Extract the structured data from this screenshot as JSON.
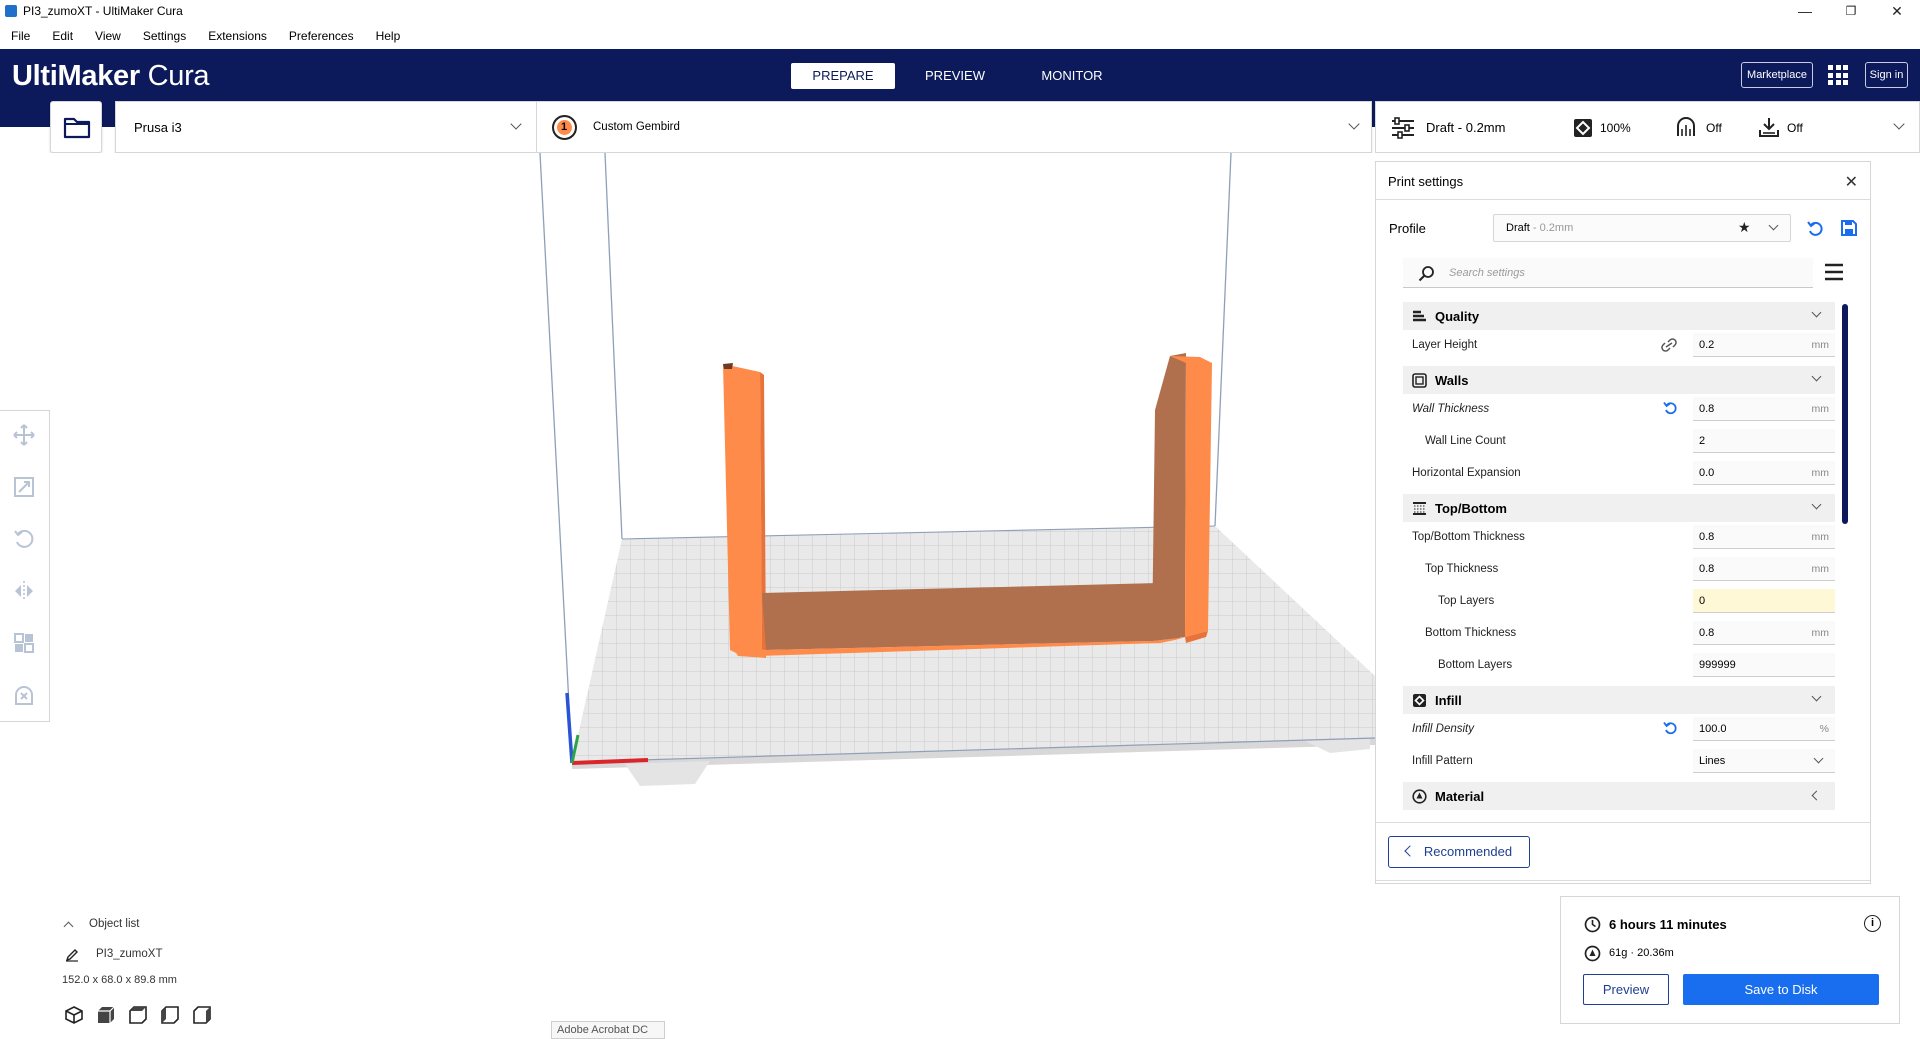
{
  "window": {
    "title": "PI3_zumoXT - UltiMaker Cura",
    "controls": {
      "minimize": "—",
      "restore": "❐",
      "close": "✕"
    }
  },
  "menu": [
    "File",
    "Edit",
    "View",
    "Settings",
    "Extensions",
    "Preferences",
    "Help"
  ],
  "header": {
    "brand_bold": "UltiMaker",
    "brand_light": " Cura",
    "tabs": [
      "PREPARE",
      "PREVIEW",
      "MONITOR"
    ],
    "active_tab": "PREPARE",
    "marketplace_label": "Marketplace",
    "signin_label": "Sign in"
  },
  "machine": {
    "printer": "Prusa i3",
    "extruder_number": "1",
    "material": "Custom Gembird"
  },
  "settings_summary": {
    "profile": "Draft - 0.2mm",
    "infill": "100%",
    "support": "Off",
    "adhesion": "Off"
  },
  "print_settings": {
    "title": "Print settings",
    "profile_label": "Profile",
    "profile_name": "Draft",
    "profile_suffix": " - 0.2mm",
    "search_placeholder": "Search settings",
    "categories": {
      "quality": "Quality",
      "walls": "Walls",
      "topbottom": "Top/Bottom",
      "infill": "Infill",
      "material": "Material"
    },
    "rows": {
      "layer_height": {
        "label": "Layer Height",
        "value": "0.2",
        "unit": "mm"
      },
      "wall_thickness": {
        "label": "Wall Thickness",
        "value": "0.8",
        "unit": "mm"
      },
      "wall_line_count": {
        "label": "Wall Line Count",
        "value": "2"
      },
      "horizontal_expansion": {
        "label": "Horizontal Expansion",
        "value": "0.0",
        "unit": "mm"
      },
      "topbottom_thickness": {
        "label": "Top/Bottom Thickness",
        "value": "0.8",
        "unit": "mm"
      },
      "top_thickness": {
        "label": "Top Thickness",
        "value": "0.8",
        "unit": "mm"
      },
      "top_layers": {
        "label": "Top Layers",
        "value": "0"
      },
      "bottom_thickness": {
        "label": "Bottom Thickness",
        "value": "0.8",
        "unit": "mm"
      },
      "bottom_layers": {
        "label": "Bottom Layers",
        "value": "999999"
      },
      "infill_density": {
        "label": "Infill Density",
        "value": "100.0",
        "unit": "%"
      },
      "infill_pattern": {
        "label": "Infill Pattern",
        "value": "Lines"
      }
    },
    "recommended_label": "Recommended"
  },
  "object_list": {
    "toggle_label": "Object list",
    "object_name": "PI3_zumoXT",
    "dimensions": "152.0 x 68.0 x 89.8 mm"
  },
  "action_panel": {
    "print_time": "6 hours 11 minutes",
    "material_usage": "61g · 20.36m",
    "preview_label": "Preview",
    "save_label": "Save to Disk"
  },
  "taskbar_tip": "Adobe Acrobat DC",
  "colors": {
    "header": "#0c1a5b",
    "model_orange": "#fe8b4a",
    "model_shadow": "#b0704e",
    "primary_blue": "#196ef0",
    "warning_field": "#fff8d6"
  }
}
